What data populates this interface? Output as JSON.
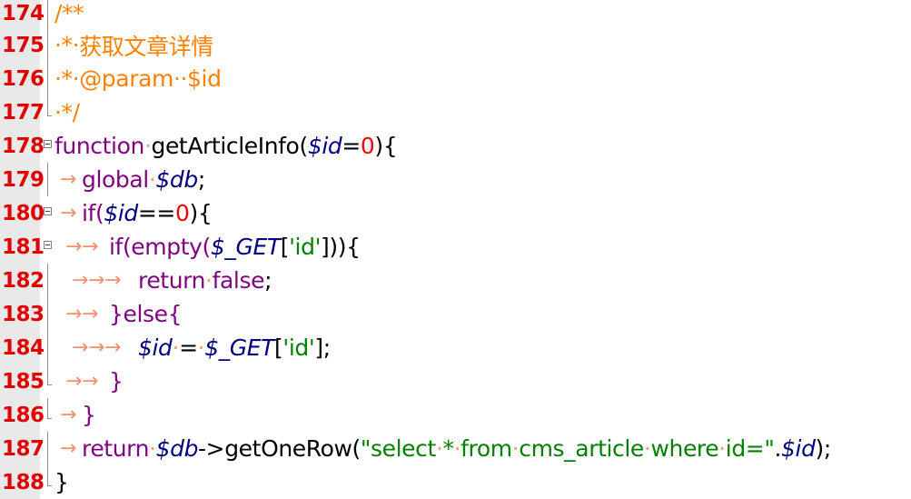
{
  "editor": {
    "language": "PHP",
    "colors": {
      "line_number": "#e00000",
      "comment": "#ff8000",
      "keyword": "#7f007f",
      "variable": "#000080",
      "number": "#ff0000",
      "string": "#008000",
      "whitespace_marker": "#f09070"
    },
    "lines": [
      {
        "number": "174",
        "text": "/**"
      },
      {
        "number": "175",
        "text": "·*·获取文章详情"
      },
      {
        "number": "176",
        "text": "·*·@param··$id"
      },
      {
        "number": "177",
        "text": "·*/"
      },
      {
        "number": "178",
        "text": "function·getArticleInfo($id=0){"
      },
      {
        "number": "179",
        "text": "→global·$db;"
      },
      {
        "number": "180",
        "text": "→if($id==0){"
      },
      {
        "number": "181",
        "text": "→→if(empty($_GET['id'])){"
      },
      {
        "number": "182",
        "text": "→→→return·false;"
      },
      {
        "number": "183",
        "text": "→→}else{"
      },
      {
        "number": "184",
        "text": "→→→$id·=·$_GET['id'];"
      },
      {
        "number": "185",
        "text": "→→}"
      },
      {
        "number": "186",
        "text": "→}"
      },
      {
        "number": "187",
        "text": "→return·$db->getOneRow(\"select·*·from·cms_article·where·id=\".$id);"
      },
      {
        "number": "188",
        "text": "}"
      }
    ],
    "tokens": {
      "l174": [
        "/**"
      ],
      "l175": [
        "·*·",
        "获取文章详情"
      ],
      "l176": [
        "·*·",
        "@param",
        "··",
        "$id"
      ],
      "l177": [
        "·*/"
      ],
      "l178": [
        "function",
        "·",
        "getArticleInfo(",
        "$id",
        "=",
        "0",
        "){"
      ],
      "l179": [
        "→",
        "global",
        "·",
        "$db",
        ";"
      ],
      "l180": [
        "→",
        "if(",
        "$id",
        "==",
        "0",
        "){"
      ],
      "l181": [
        "→→",
        "if(empty(",
        "$_GET",
        "[",
        "'id'",
        "])){"
      ],
      "l182": [
        "→→→",
        "return",
        "·",
        "false",
        ";"
      ],
      "l183": [
        "→→",
        "}else{"
      ],
      "l184": [
        "→→→",
        "$id",
        "·",
        "=",
        "·",
        "$_GET",
        "[",
        "'id'",
        "];"
      ],
      "l185": [
        "→→",
        "}"
      ],
      "l186": [
        "→",
        "}"
      ],
      "l187": [
        "→",
        "return",
        "·",
        "$db",
        "->getOneRow(",
        "\"select",
        "·",
        "*",
        "·",
        "from",
        "·",
        "cms_article",
        "·",
        "where",
        "·",
        "id=\"",
        ".",
        "$id",
        ");"
      ],
      "l188": [
        "}"
      ]
    }
  }
}
